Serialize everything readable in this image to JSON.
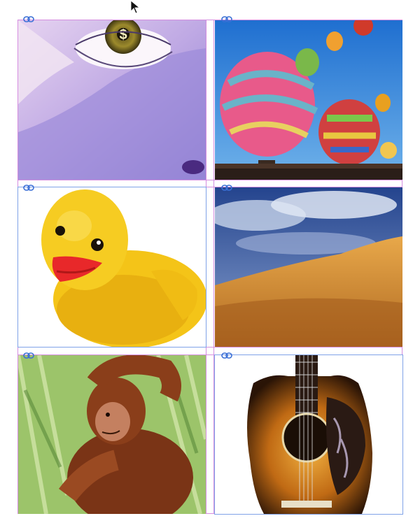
{
  "document": {
    "page_width_label": "",
    "frames": [
      {
        "id": "eye",
        "subject": "eye-with-dollar-sign"
      },
      {
        "id": "balloons",
        "subject": "hot-air-balloons"
      },
      {
        "id": "duck",
        "subject": "rubber-duck"
      },
      {
        "id": "desert",
        "subject": "desert-dune"
      },
      {
        "id": "monkey",
        "subject": "orangutan"
      },
      {
        "id": "guitar",
        "subject": "acoustic-guitar"
      }
    ]
  },
  "colors": {
    "guide_magenta": "#d58ee0",
    "frame_selection_blue": "#7fa2e8",
    "link_icon_blue": "#3a6fd6"
  },
  "icons": [
    "link-icon",
    "arrow-pointer-icon"
  ]
}
